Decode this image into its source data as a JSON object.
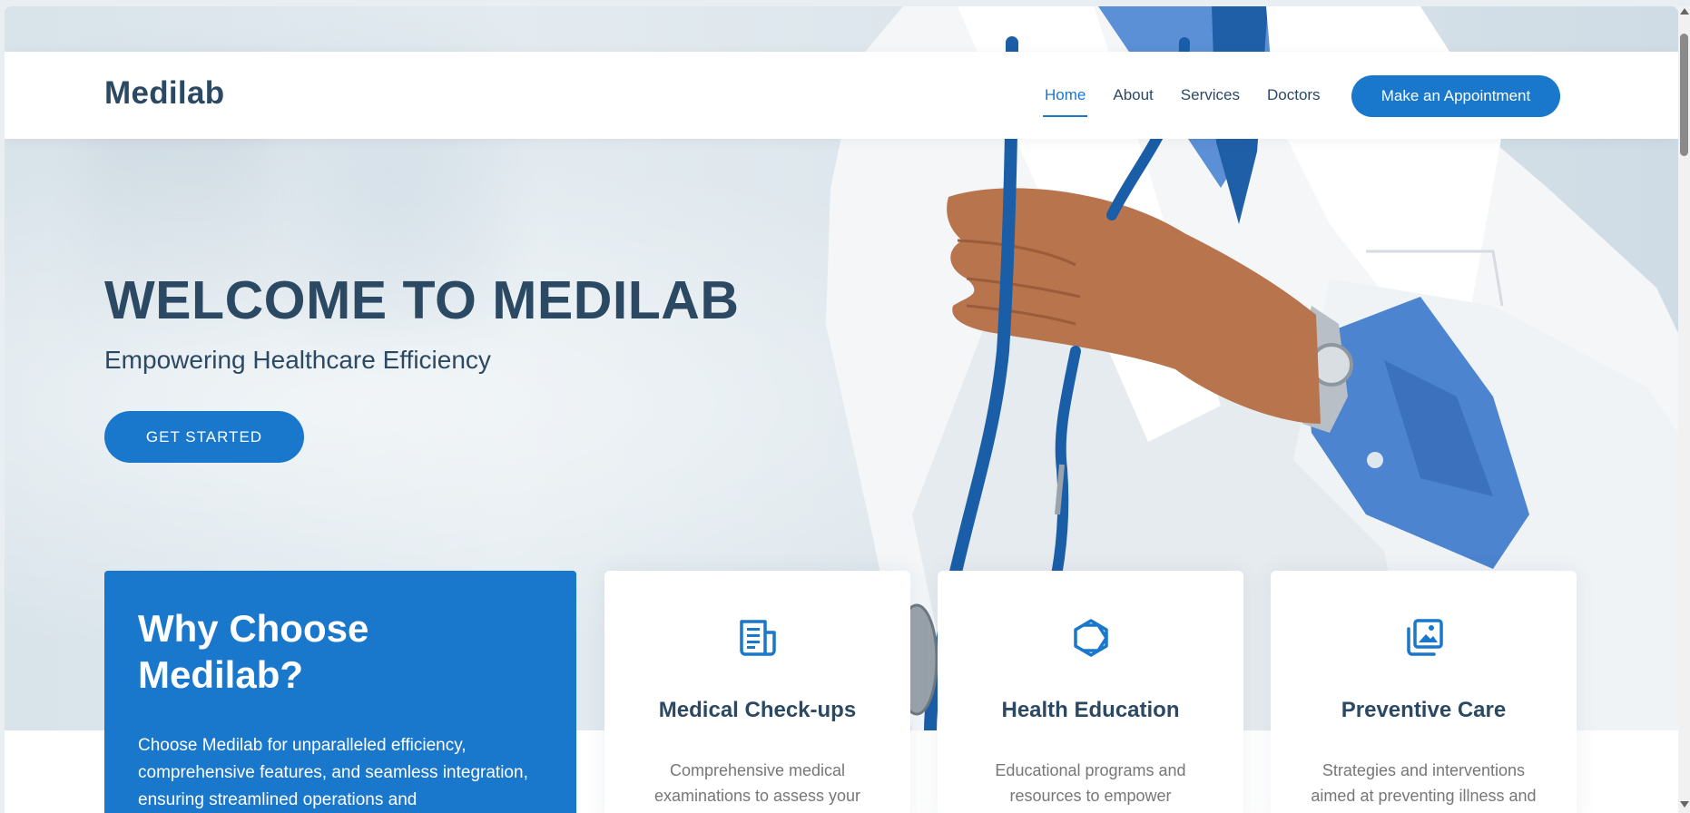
{
  "header": {
    "logo": "Medilab",
    "nav": [
      {
        "label": "Home",
        "active": true
      },
      {
        "label": "About",
        "active": false
      },
      {
        "label": "Services",
        "active": false
      },
      {
        "label": "Doctors",
        "active": false
      }
    ],
    "appointment_button": "Make an Appointment"
  },
  "hero": {
    "title": "WELCOME TO MEDILAB",
    "subtitle": "Empowering Healthcare Efficiency",
    "cta": "GET STARTED"
  },
  "why": {
    "title": "Why Choose Medilab?",
    "text": "Choose Medilab for unparalleled efficiency, comprehensive features, and seamless integration, ensuring streamlined operations and"
  },
  "cards": [
    {
      "icon": "document-icon",
      "title": "Medical Check-ups",
      "text": "Comprehensive medical examinations to assess your"
    },
    {
      "icon": "cube-icon",
      "title": "Health Education",
      "text": "Educational programs and resources to empower"
    },
    {
      "icon": "images-icon",
      "title": "Preventive Care",
      "text": "Strategies and interventions aimed at preventing illness and"
    }
  ],
  "colors": {
    "accent": "#1977cc",
    "heading": "#2c4964",
    "body_text": "#777777"
  }
}
